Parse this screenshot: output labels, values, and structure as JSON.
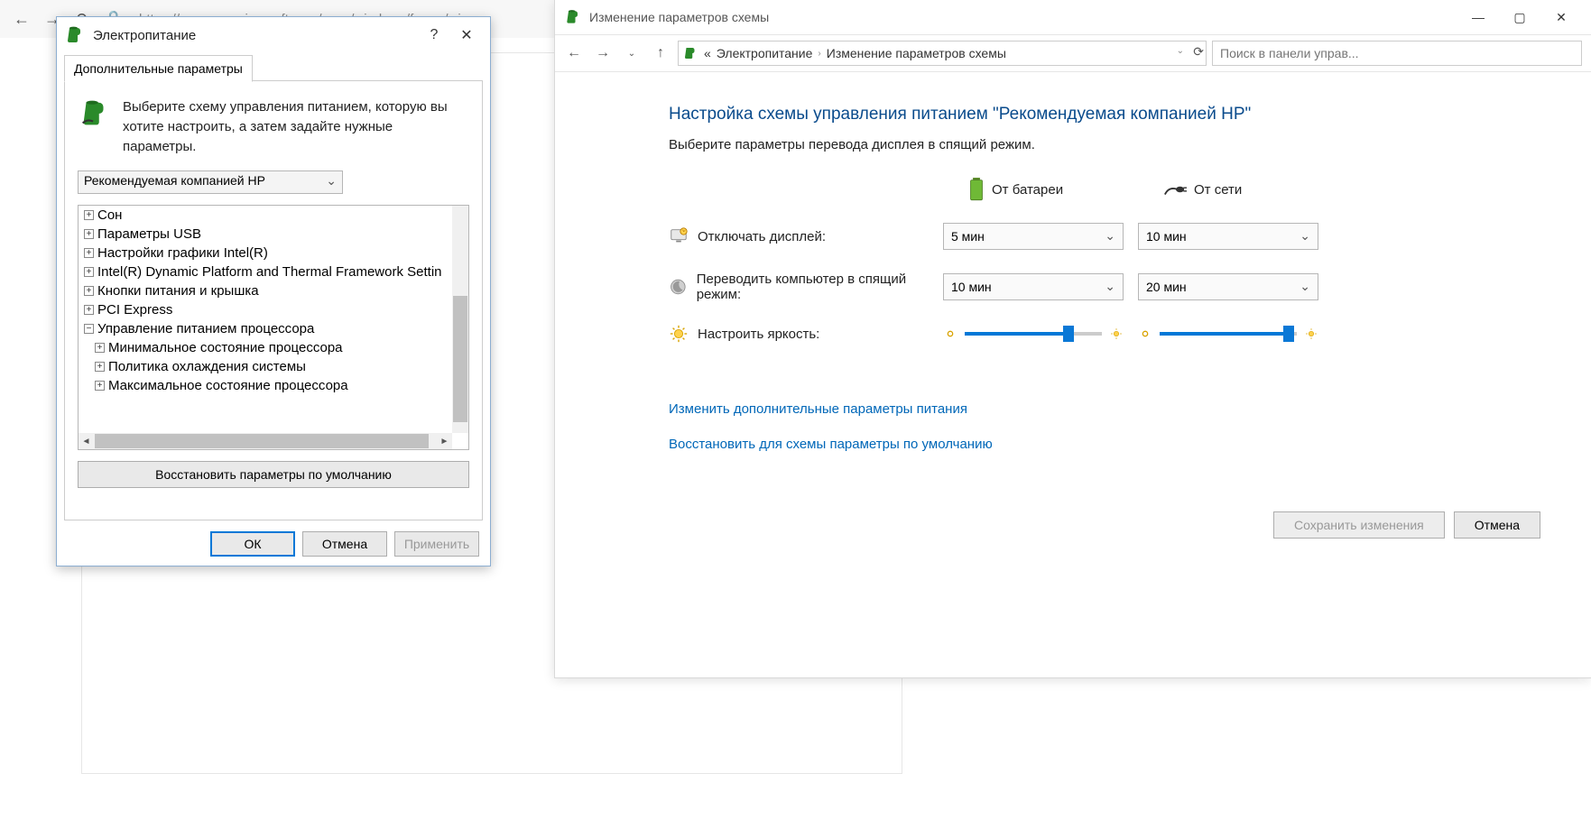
{
  "browser": {
    "url": "https://answers.microsoft.com/ru-ru/windows/forum/wi"
  },
  "advanced_dialog": {
    "title": "Электропитание",
    "tab": "Дополнительные параметры",
    "instruction": "Выберите схему управления питанием, которую вы хотите настроить, а затем задайте нужные параметры.",
    "scheme_selected": "Рекомендуемая компанией HP",
    "tree": {
      "sleep": "Сон",
      "usb": "Параметры USB",
      "intel_gfx": "Настройки графики Intel(R)",
      "intel_dptf": "Intel(R) Dynamic Platform and Thermal Framework Settin",
      "buttons_lid": "Кнопки питания и крышка",
      "pci": "PCI Express",
      "cpu": "Управление питанием процессора",
      "cpu_min": "Минимальное состояние процессора",
      "cooling": "Политика охлаждения системы",
      "cpu_max": "Максимальное состояние процессора"
    },
    "restore_defaults": "Восстановить параметры по умолчанию",
    "ok": "ОК",
    "cancel": "Отмена",
    "apply": "Применить"
  },
  "edit_window": {
    "title": "Изменение параметров схемы",
    "breadcrumb_lvl1": "Электропитание",
    "breadcrumb_lvl2": "Изменение параметров схемы",
    "search_placeholder": "Поиск в панели управ...",
    "heading": "Настройка схемы управления питанием \"Рекомендуемая компанией HP\"",
    "subtitle": "Выберите параметры перевода дисплея в спящий режим.",
    "col_battery": "От батареи",
    "col_ac": "От сети",
    "row_display_off": "Отключать дисплей:",
    "row_sleep": "Переводить компьютер в спящий режим:",
    "row_brightness": "Настроить яркость:",
    "display_off_battery": "5 мин",
    "display_off_ac": "10 мин",
    "sleep_battery": "10 мин",
    "sleep_ac": "20 мин",
    "link_advanced": "Изменить дополнительные параметры питания",
    "link_restore": "Восстановить для схемы параметры по умолчанию",
    "save": "Сохранить изменения",
    "cancel": "Отмена"
  }
}
